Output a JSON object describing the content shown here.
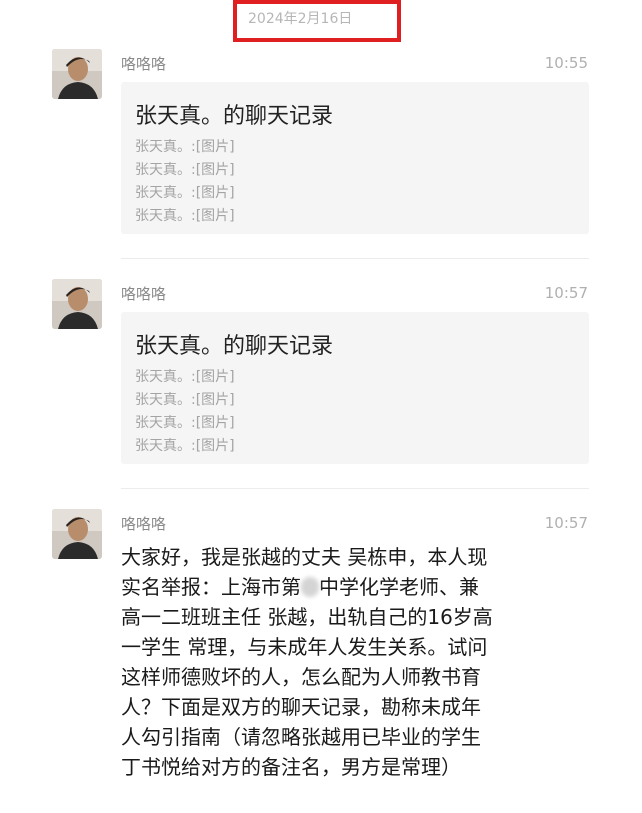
{
  "date_label": "2024年2月16日",
  "messages": [
    {
      "sender": "咯咯咯",
      "time": "10:55",
      "card": {
        "title": "张天真。的聊天记录",
        "lines": [
          "张天真。:[图片]",
          "张天真。:[图片]",
          "张天真。:[图片]",
          "张天真。:[图片]"
        ]
      }
    },
    {
      "sender": "咯咯咯",
      "time": "10:57",
      "card": {
        "title": "张天真。的聊天记录",
        "lines": [
          "张天真。:[图片]",
          "张天真。:[图片]",
          "张天真。:[图片]",
          "张天真。:[图片]"
        ]
      }
    },
    {
      "sender": "咯咯咯",
      "time": "10:57",
      "text_lines": [
        "大家好，我是张越的丈夫 吴栋申，本人现",
        "实名举报：上海市第",
        "中学化学老师、兼",
        "高一二班班主任 张越，出轨自己的16岁高",
        "一学生 常理，与未成年人发生关系。试问",
        "这样师德败坏的人，怎么配为人师教书育",
        "人？下面是双方的聊天记录，勘称未成年",
        "人勾引指南（请忽略张越用已毕业的学生",
        "丁书悦给对方的备注名，男方是常理）"
      ]
    }
  ],
  "colors": {
    "highlight_box": "#e02020",
    "card_bg": "#f5f5f5",
    "meta_text": "#8a8a8a"
  },
  "icons": {
    "avatar": "user-avatar-photo"
  }
}
